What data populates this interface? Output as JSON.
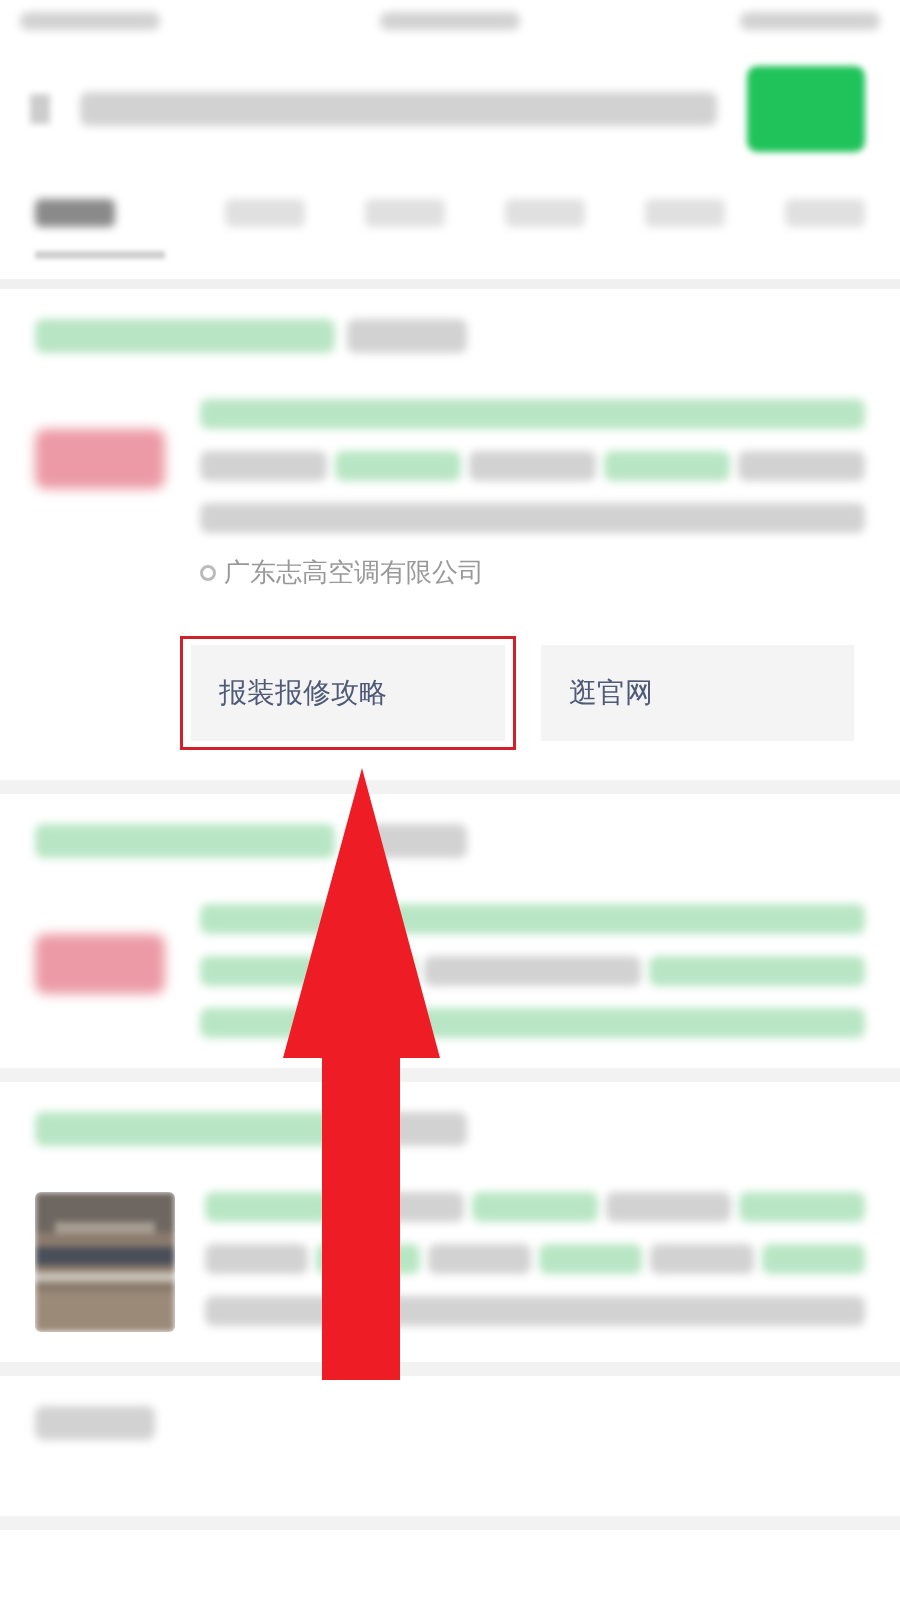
{
  "tabs": [
    {
      "selected": true
    },
    {
      "selected": false
    },
    {
      "selected": false
    },
    {
      "selected": false
    },
    {
      "selected": false
    },
    {
      "selected": false
    }
  ],
  "results": [
    {
      "kind": "account",
      "company": "广东志高空调有限公司",
      "actions": [
        {
          "label": "报装报修攻略",
          "highlighted": true
        },
        {
          "label": "逛官网",
          "highlighted": false
        }
      ]
    },
    {
      "kind": "channel"
    },
    {
      "kind": "article"
    },
    {
      "kind": "related"
    }
  ],
  "annotation": {
    "kind": "arrow"
  }
}
